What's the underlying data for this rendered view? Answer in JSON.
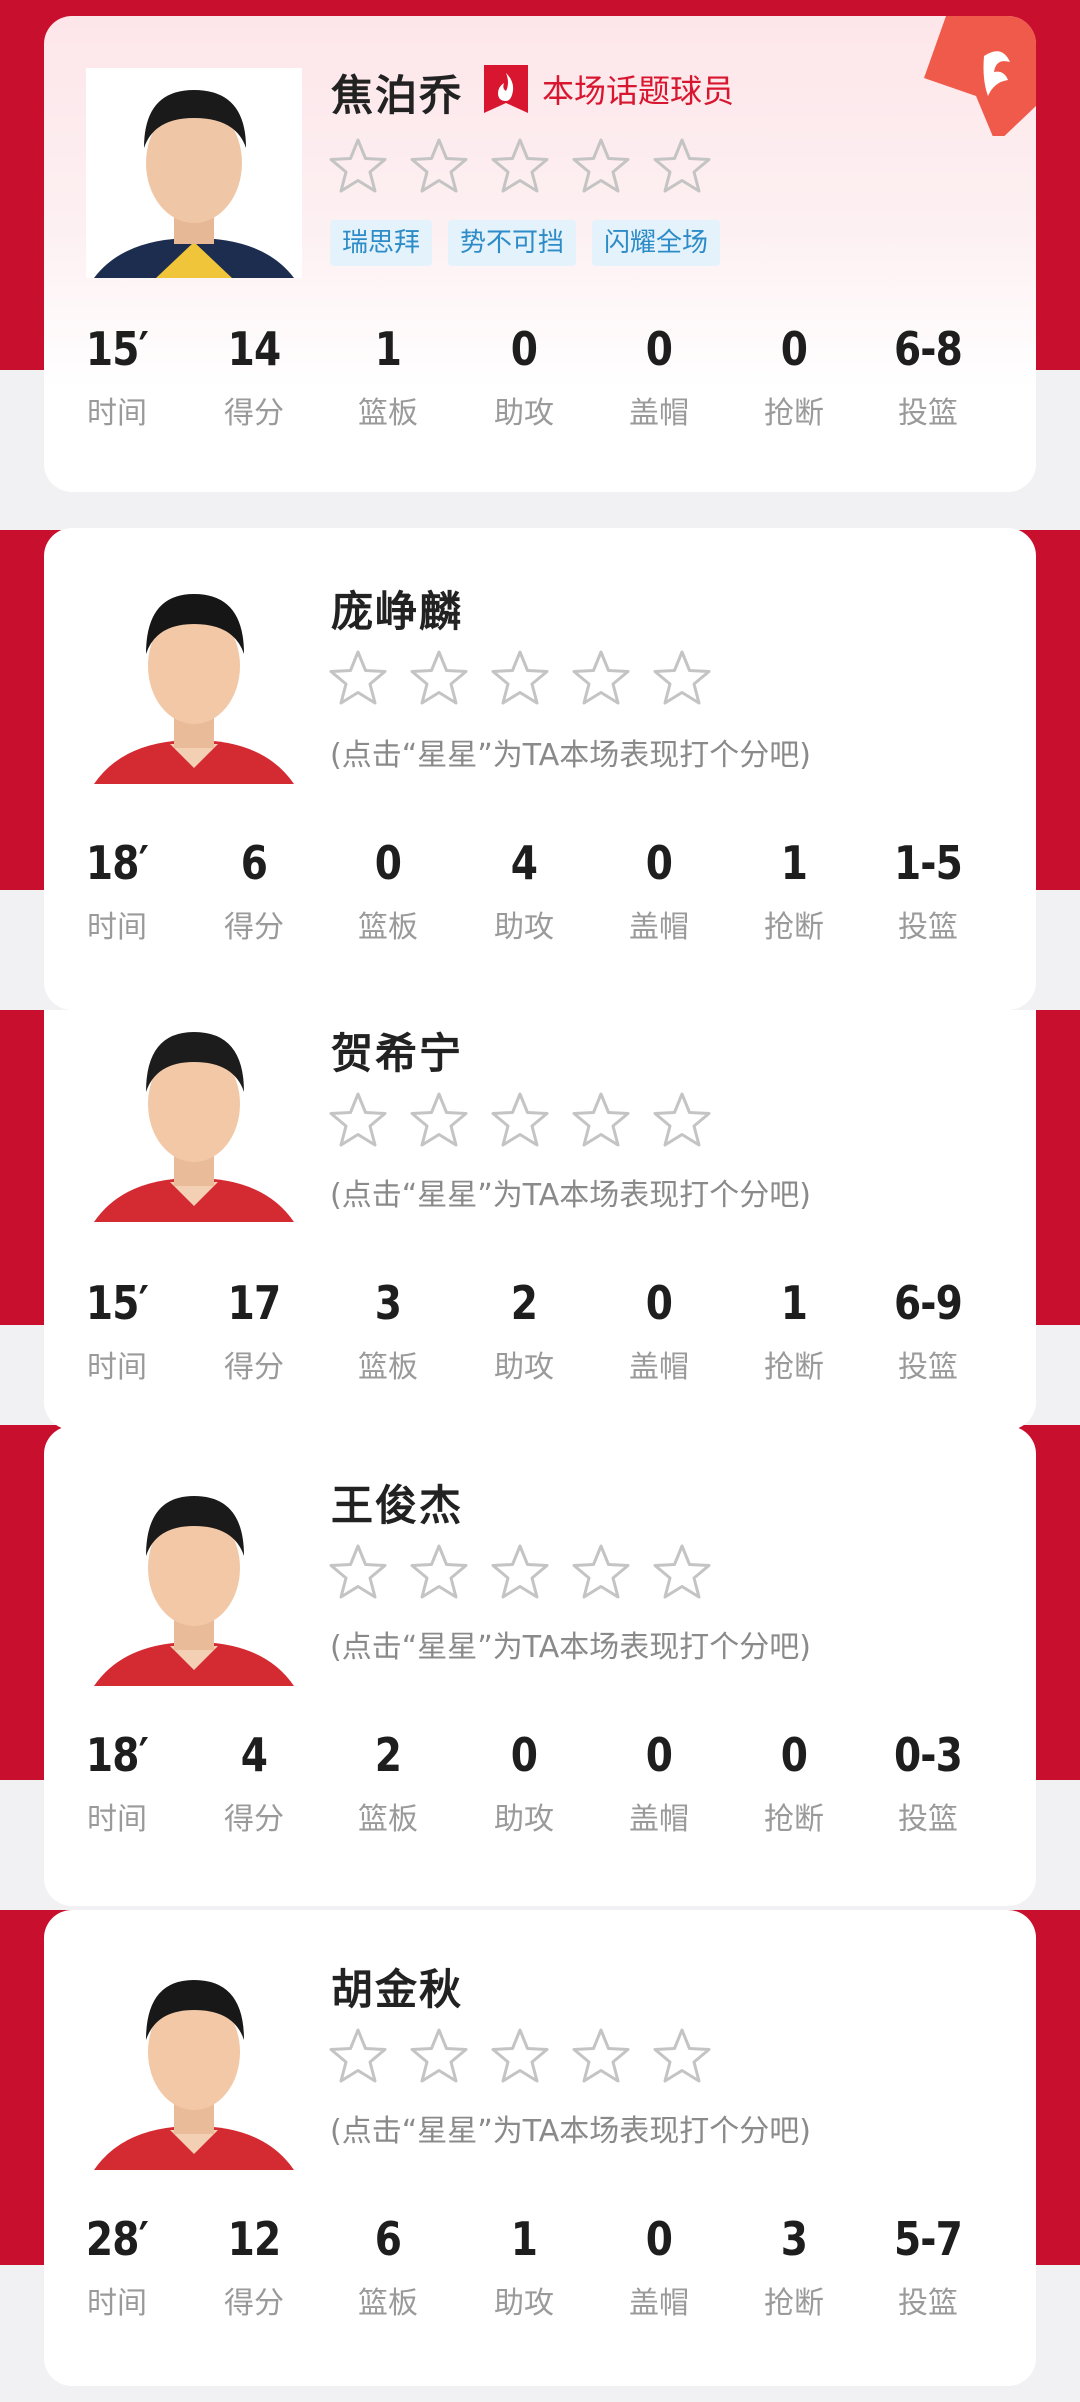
{
  "featured_tag": "本场话题球员",
  "rating_hint": "(点击“星星”为TA本场表现打个分吧)",
  "stat_labels": [
    "时间",
    "得分",
    "篮板",
    "助攻",
    "盖帽",
    "抢断",
    "投篮"
  ],
  "colors": {
    "brand_red": "#c8102e",
    "tag_blue": "#2d8cc8",
    "star_outline": "#c4c4c4"
  },
  "players": [
    {
      "name": "焦泊乔",
      "featured": true,
      "stars": 0,
      "tags": [
        "瑞思拜",
        "势不可挡",
        "闪耀全场"
      ],
      "stats": [
        "15′",
        "14",
        "1",
        "0",
        "0",
        "0",
        "6-8"
      ]
    },
    {
      "name": "庞峥麟",
      "featured": false,
      "stars": 0,
      "stats": [
        "18′",
        "6",
        "0",
        "4",
        "0",
        "1",
        "1-5"
      ]
    },
    {
      "name": "贺希宁",
      "featured": false,
      "stars": 0,
      "stats": [
        "15′",
        "17",
        "3",
        "2",
        "0",
        "1",
        "6-9"
      ]
    },
    {
      "name": "王俊杰",
      "featured": false,
      "stars": 0,
      "stats": [
        "18′",
        "4",
        "2",
        "0",
        "0",
        "0",
        "0-3"
      ]
    },
    {
      "name": "胡金秋",
      "featured": false,
      "stars": 0,
      "stats": [
        "28′",
        "12",
        "6",
        "1",
        "0",
        "3",
        "5-7"
      ]
    }
  ]
}
